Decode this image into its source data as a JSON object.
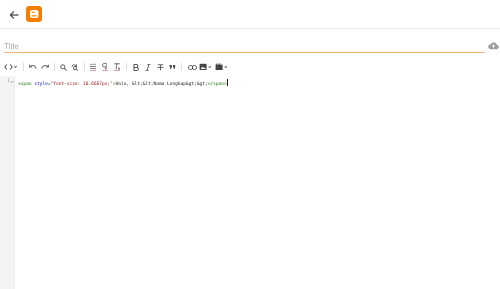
{
  "header": {
    "back_icon": "arrow-left-icon",
    "logo_icon": "blogger-logo-icon",
    "brand_color": "#f57d00"
  },
  "title": {
    "placeholder": "Title",
    "value": "",
    "underline_color": "#f0b074",
    "save_status_icon": "cloud-icon"
  },
  "toolbar": {
    "items": [
      {
        "icon": "code-view-switch-icon"
      },
      {
        "icon": "undo-icon"
      },
      {
        "icon": "redo-icon"
      },
      {
        "icon": "search-icon"
      },
      {
        "icon": "search-replace-icon"
      },
      {
        "icon": "format-code-icon"
      },
      {
        "icon": "paragraph-icon"
      },
      {
        "icon": "clear-format-icon"
      },
      {
        "icon": "bold-icon"
      },
      {
        "icon": "italic-icon"
      },
      {
        "icon": "strikethrough-icon"
      },
      {
        "icon": "quote-icon"
      },
      {
        "icon": "link-icon"
      },
      {
        "icon": "image-icon"
      },
      {
        "icon": "video-icon"
      }
    ]
  },
  "editor": {
    "line_number": "1",
    "tokens": {
      "open_tag": "<span",
      "attr_name": " style",
      "equals": "=",
      "attr_value": "\"font-size: 10.6667px;\"",
      "open_close": ">",
      "text": "Halo, &lt;&lt;Nama Lengkap&gt;&gt;",
      "close_tag": "</span>"
    },
    "colors": {
      "tag": "#117700",
      "attribute": "#0000cc",
      "string": "#aa1111",
      "text": "#222222"
    }
  }
}
